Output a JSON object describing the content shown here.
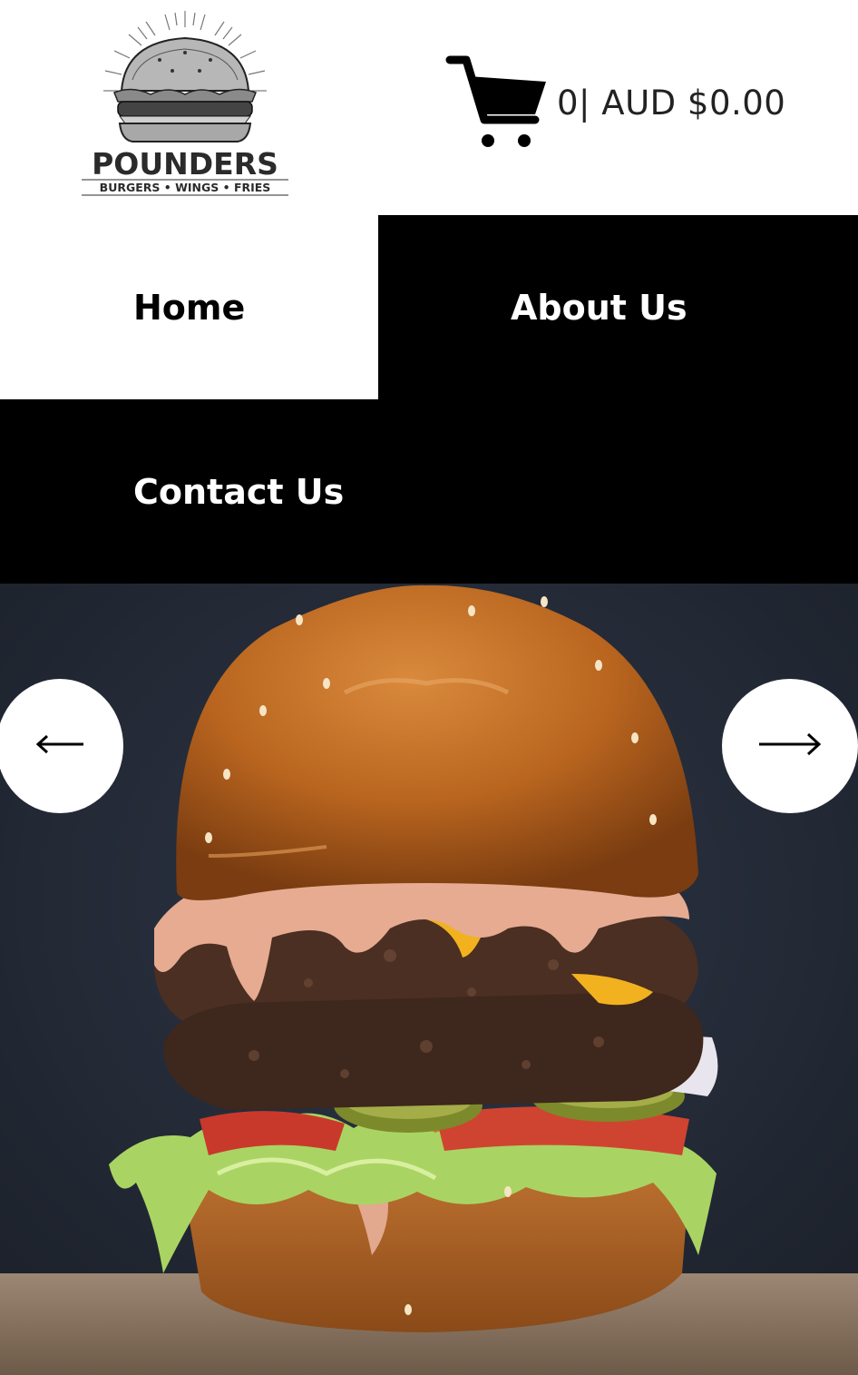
{
  "brand": {
    "name": "POUNDERS",
    "tagline": "BURGERS • WINGS • FRIES"
  },
  "cart": {
    "icon": "shopping-cart-icon",
    "summary": "0| AUD $0.00"
  },
  "nav": {
    "items": [
      {
        "label": "Home"
      },
      {
        "label": "About Us"
      },
      {
        "label": "Contact Us"
      }
    ]
  },
  "slider": {
    "prev_icon": "arrow-left-icon",
    "next_icon": "arrow-right-icon"
  },
  "colors": {
    "background": "#ffffff",
    "nav_dark": "#000000",
    "hero_backdrop": "#232a38",
    "bun": "#b9651f"
  }
}
